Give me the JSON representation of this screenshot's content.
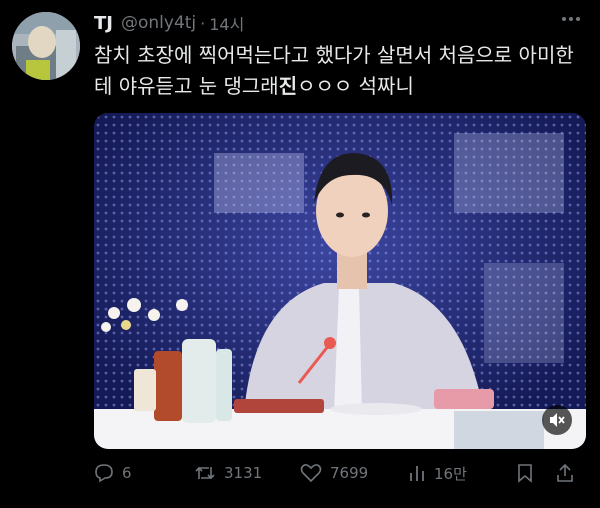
{
  "tweet": {
    "display_name": "TJ",
    "handle": "@only4tj",
    "separator": "·",
    "time": "14시",
    "more_icon": "ellipsis-icon",
    "text_before": "참치 초장에 찍어먹는다고 했다가 살면서 처음으로 아미한테 야유듣고 눈 댕그래",
    "text_bold": "진",
    "text_after": "ㅇㅇㅇ 석짜니"
  },
  "media": {
    "type": "video",
    "mute_icon": "volume-muted-icon"
  },
  "actions": {
    "reply_count": "6",
    "retweet_count": "3131",
    "like_count": "7699",
    "views_count": "16만"
  },
  "colors": {
    "background": "#000000",
    "primary_text": "#e7e9ea",
    "secondary_text": "#71767b"
  }
}
